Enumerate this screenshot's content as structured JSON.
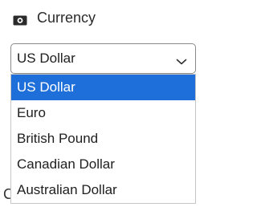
{
  "field": {
    "label": "Currency",
    "icon": "money-icon"
  },
  "select": {
    "selected_value": "US Dollar",
    "options": [
      {
        "label": "US Dollar",
        "selected": true
      },
      {
        "label": "Euro",
        "selected": false
      },
      {
        "label": "British Pound",
        "selected": false
      },
      {
        "label": "Canadian Dollar",
        "selected": false
      },
      {
        "label": "Australian Dollar",
        "selected": false
      }
    ]
  },
  "background_fragment": {
    "text": "C"
  },
  "colors": {
    "highlight": "#1e6fd9",
    "border": "#8a8a8a"
  }
}
